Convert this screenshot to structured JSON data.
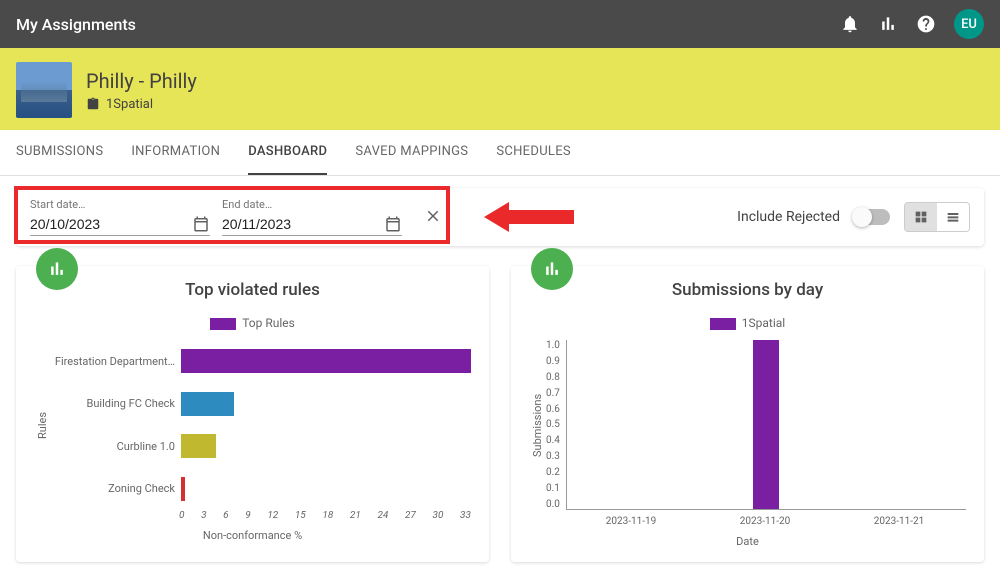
{
  "header": {
    "title": "My Assignments",
    "avatar": "EU"
  },
  "project": {
    "title": "Philly - Philly",
    "org": "1Spatial"
  },
  "tabs": [
    "SUBMISSIONS",
    "INFORMATION",
    "DASHBOARD",
    "SAVED MAPPINGS",
    "SCHEDULES"
  ],
  "active_tab": "DASHBOARD",
  "filters": {
    "start_label": "Start date…",
    "start_value": "20/10/2023",
    "end_label": "End date…",
    "end_value": "20/11/2023",
    "include_rejected_label": "Include Rejected",
    "include_rejected": false
  },
  "chart_data": [
    {
      "type": "bar",
      "orientation": "horizontal",
      "title": "Top violated rules",
      "legend": "Top Rules",
      "ylabel": "Rules",
      "xlabel": "Non-conformance %",
      "xlim": [
        0,
        33
      ],
      "xticks": [
        0,
        3,
        6,
        9,
        12,
        15,
        18,
        21,
        24,
        27,
        30,
        33
      ],
      "categories": [
        "Firestation Department…",
        "Building FC Check",
        "Curbline 1.0",
        "Zoning Check"
      ],
      "values": [
        33,
        6,
        4,
        0.5
      ],
      "colors": [
        "#7b1fa2",
        "#2e8bc0",
        "#c0b82e",
        "#d62f2f"
      ]
    },
    {
      "type": "bar",
      "orientation": "vertical",
      "title": "Submissions by day",
      "legend": "1Spatial",
      "ylabel": "Submissions",
      "xlabel": "Date",
      "ylim": [
        0.0,
        1.0
      ],
      "yticks": [
        1.0,
        0.9,
        0.8,
        0.7,
        0.6,
        0.5,
        0.4,
        0.3,
        0.2,
        0.1,
        0.0
      ],
      "categories": [
        "2023-11-19",
        "2023-11-20",
        "2023-11-21"
      ],
      "values": [
        0,
        1.0,
        0
      ],
      "color": "#7b1fa2"
    }
  ]
}
